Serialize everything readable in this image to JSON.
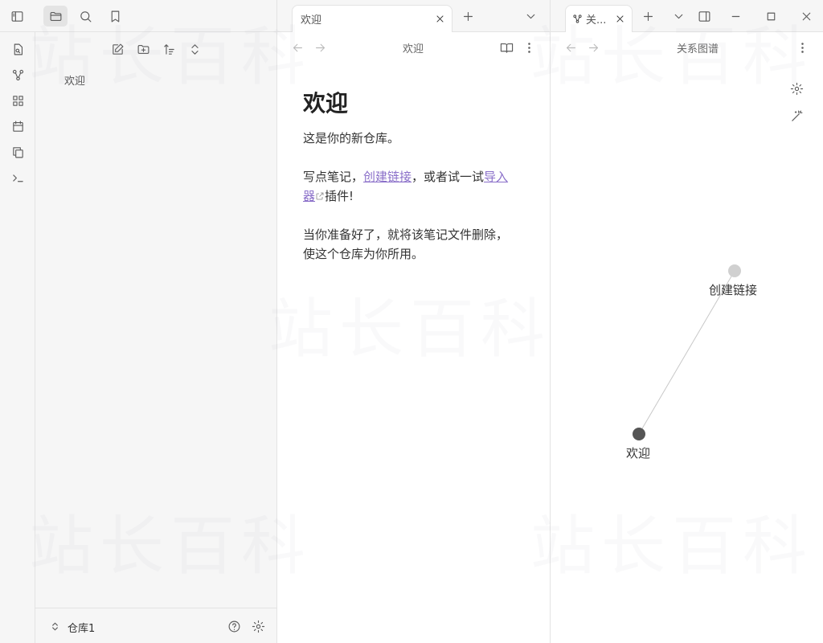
{
  "window": {
    "tabs": [
      {
        "label": "欢迎"
      },
      {
        "label": "关..."
      }
    ]
  },
  "explorer": {
    "items": [
      "欢迎"
    ],
    "vault_name": "仓库1"
  },
  "editor": {
    "header_title": "欢迎",
    "heading": "欢迎",
    "para1": "这是你的新仓库。",
    "para2_before": "写点笔记，",
    "para2_link1": "创建链接",
    "para2_middle": "，或者试一试",
    "para2_link2": "导入器",
    "para2_after": "插件!",
    "para3": "当你准备好了，就将该笔记文件删除，使这个仓库为你所用。"
  },
  "graph": {
    "header_title": "关系图谱",
    "nodes": [
      {
        "label": "创建链接",
        "color": "#d0d0d0"
      },
      {
        "label": "欢迎",
        "color": "#555555"
      }
    ]
  },
  "watermark": "站长百科",
  "colors": {
    "link": "#8a6fc9",
    "chrome": "#f6f6f6",
    "border": "#e3e3e3"
  }
}
